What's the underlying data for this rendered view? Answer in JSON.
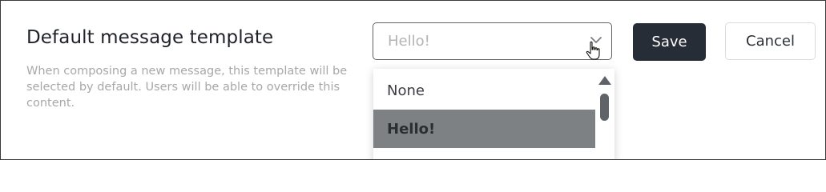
{
  "setting": {
    "title": "Default message template",
    "description": "When composing a new message, this template will be selected by default. Users will be able to override this content."
  },
  "template_select": {
    "selected_value": "Hello!",
    "icon": "chevron-down-icon"
  },
  "actions": {
    "save_label": "Save",
    "cancel_label": "Cancel"
  },
  "dropdown": {
    "options": [
      {
        "label": "None",
        "highlighted": false
      },
      {
        "label": "Hello!",
        "highlighted": true
      }
    ]
  },
  "colors": {
    "primary_button": "#272d36",
    "highlighted_option": "#7e8184",
    "description_text": "#a8a8a8"
  }
}
